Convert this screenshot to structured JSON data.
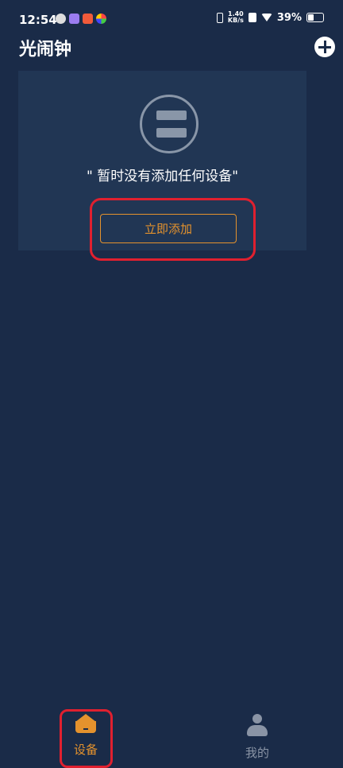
{
  "status_bar": {
    "time": "12:54",
    "net_speed": "1.40\nKB/s",
    "battery": "39%"
  },
  "app_bar": {
    "title": "光闹钟"
  },
  "empty_state": {
    "message": "\" 暂时没有添加任何设备\"",
    "add_button_label": "立即添加"
  },
  "tabs": [
    {
      "label": "设备",
      "icon": "home-icon",
      "active": true
    },
    {
      "label": "我的",
      "icon": "person-icon",
      "active": false
    }
  ],
  "colors": {
    "background": "#1a2b48",
    "card": "#213654",
    "accent": "#e4922d",
    "highlight": "#e0202f"
  }
}
